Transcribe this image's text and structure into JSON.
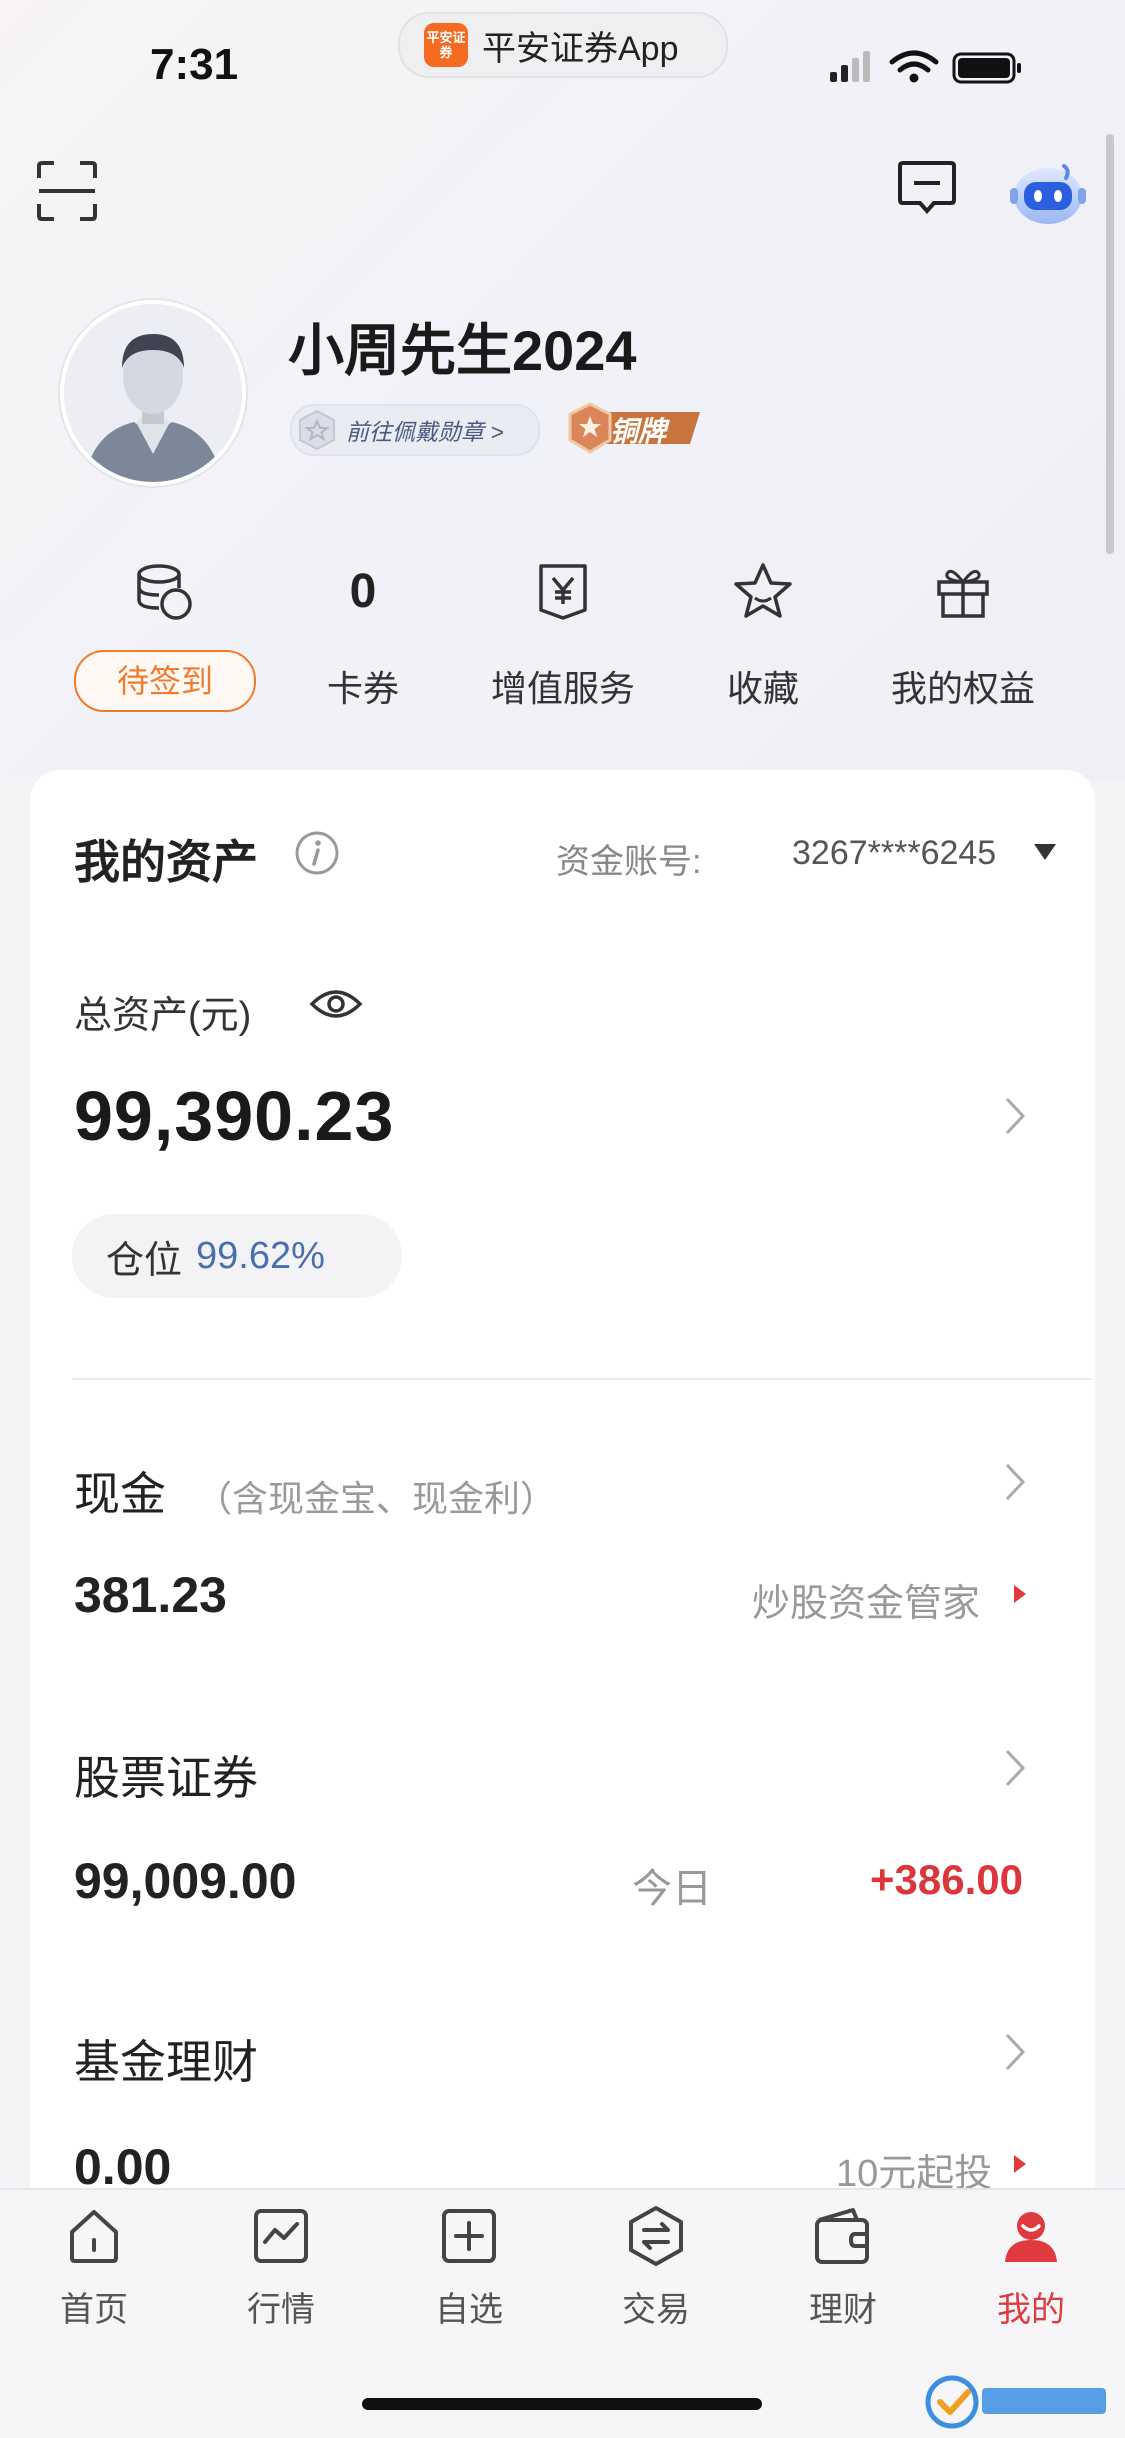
{
  "status_bar": {
    "time": "7:31",
    "app_name": "平安证券App",
    "app_logo_text": "平安证券"
  },
  "header": {
    "icons": [
      "scan-icon",
      "message-icon",
      "robot-assistant-icon"
    ]
  },
  "profile": {
    "username": "小周先生2024",
    "badge_link": "前往佩戴勋章 >",
    "medal_label": "铜牌"
  },
  "quick_actions": [
    {
      "value": "",
      "label": "待签到",
      "icon": "coins-icon"
    },
    {
      "value": "0",
      "label": "卡券",
      "icon": ""
    },
    {
      "value": "",
      "label": "增值服务",
      "icon": "yen-bag-icon"
    },
    {
      "value": "",
      "label": "收藏",
      "icon": "star-icon"
    },
    {
      "value": "",
      "label": "我的权益",
      "icon": "gift-icon"
    }
  ],
  "assets": {
    "title": "我的资产",
    "account_label": "资金账号:",
    "account_number": "3267****6245",
    "total_label": "总资产(元)",
    "total_value": "99,390.23",
    "position_label": "仓位",
    "position_value": "99.62%",
    "cash": {
      "title": "现金",
      "subtitle": "（含现金宝、现金利）",
      "value": "381.23",
      "link": "炒股资金管家"
    },
    "stocks": {
      "title": "股票证券",
      "value": "99,009.00",
      "today_label": "今日",
      "today_value": "+386.00"
    },
    "funds": {
      "title": "基金理财",
      "value": "0.00",
      "link": "10元起投"
    }
  },
  "tabs": [
    {
      "label": "首页",
      "icon": "home-icon"
    },
    {
      "label": "行情",
      "icon": "chart-icon"
    },
    {
      "label": "自选",
      "icon": "add-square-icon"
    },
    {
      "label": "交易",
      "icon": "exchange-icon"
    },
    {
      "label": "理财",
      "icon": "wallet-icon"
    },
    {
      "label": "我的",
      "icon": "profile-icon"
    }
  ],
  "colors": {
    "accent_orange": "#f07b2c",
    "active_red": "#e0393e",
    "position_blue": "#4a6fb0",
    "gain_red": "#d9373b"
  }
}
